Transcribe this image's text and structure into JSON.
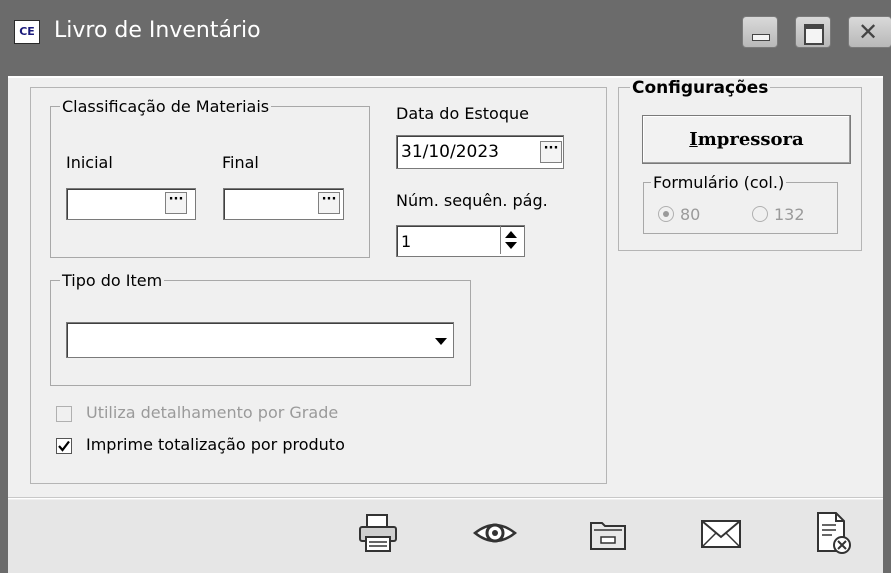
{
  "window": {
    "title": "Livro de Inventário",
    "app_icon_text": "CE"
  },
  "classificacao": {
    "group_label": "Classificação de Materiais",
    "inicial_label": "Inicial",
    "final_label": "Final",
    "inicial_value": "",
    "final_value": "",
    "ellipsis": "···"
  },
  "data_estoque": {
    "label": "Data do Estoque",
    "value": "31/10/2023",
    "ellipsis": "···"
  },
  "num_seq": {
    "label": "Núm. sequên. pág.",
    "value": "1"
  },
  "tipo_item": {
    "group_label": "Tipo do Item",
    "selected": ""
  },
  "options": {
    "grade_label": "Utiliza detalhamento por Grade",
    "grade_checked": false,
    "grade_enabled": false,
    "totalizacao_label": "Imprime totalização por produto",
    "totalizacao_checked": true
  },
  "config": {
    "group_label": "Configurações",
    "impressora_accel": "I",
    "impressora_rest": "mpressora",
    "formulario_label": "Formulário (col.)",
    "opt80": "80",
    "opt132": "132",
    "selected": "80"
  },
  "toolbar": {
    "buttons": [
      "printer-icon",
      "eye-icon",
      "folder-icon",
      "envelope-icon",
      "document-close-icon"
    ]
  }
}
